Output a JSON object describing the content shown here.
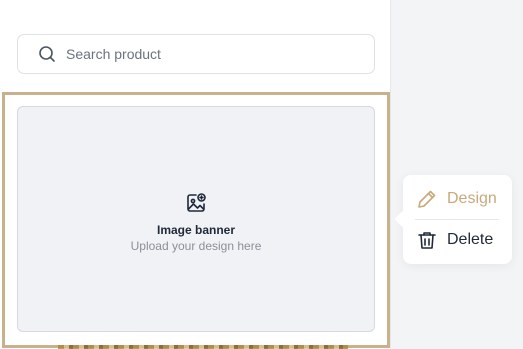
{
  "search": {
    "placeholder": "Search product"
  },
  "banner": {
    "title": "Image banner",
    "subtitle": "Upload your design here"
  },
  "context_menu": {
    "items": [
      {
        "label": "Design",
        "icon": "pencil-icon",
        "color": "#c8a97c"
      },
      {
        "label": "Delete",
        "icon": "trash-icon",
        "color": "#1f2937"
      }
    ]
  },
  "colors": {
    "accent": "#c8b28c",
    "panel_bg": "#ffffff",
    "canvas_bg": "#f3f4f6"
  }
}
